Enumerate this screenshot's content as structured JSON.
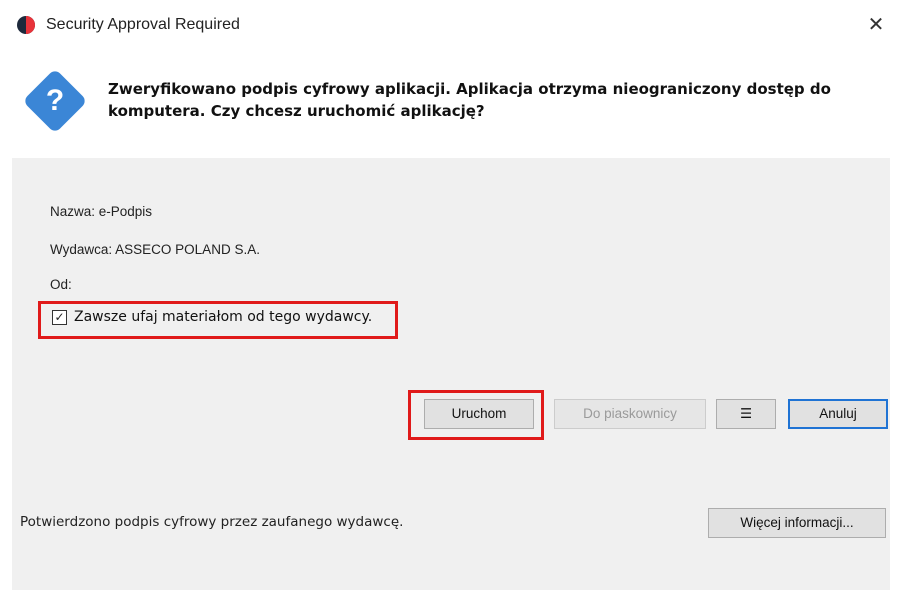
{
  "window": {
    "title": "Security Approval Required",
    "close_glyph": "✕",
    "app_icon": "java-icon"
  },
  "header": {
    "icon": "question-icon",
    "icon_glyph": "?",
    "message": "Zweryfikowano podpis cyfrowy aplikacji. Aplikacja otrzyma nieograniczony dostęp do komputera. Czy chcesz uruchomić aplikację?"
  },
  "details": {
    "name": "Nazwa:  e-Podpis",
    "publisher": "Wydawca: ASSECO POLAND S.A.",
    "from": "Od:"
  },
  "trust_checkbox": {
    "label": "Zawsze ufaj materiałom od tego wydawcy.",
    "checked": true,
    "check_glyph": "✓"
  },
  "buttons": {
    "run": "Uruchom",
    "sandbox": "Do piaskownicy",
    "menu": "☰",
    "cancel": "Anuluj",
    "more_info": "Więcej informacji..."
  },
  "footer": {
    "status": "Potwierdzono podpis cyfrowy przez zaufanego wydawcę."
  },
  "colors": {
    "highlight": "#e01a1a",
    "question_icon": "#3b86d6",
    "default_button_border": "#1f73d4",
    "panel_bg": "#f0f0f0"
  }
}
